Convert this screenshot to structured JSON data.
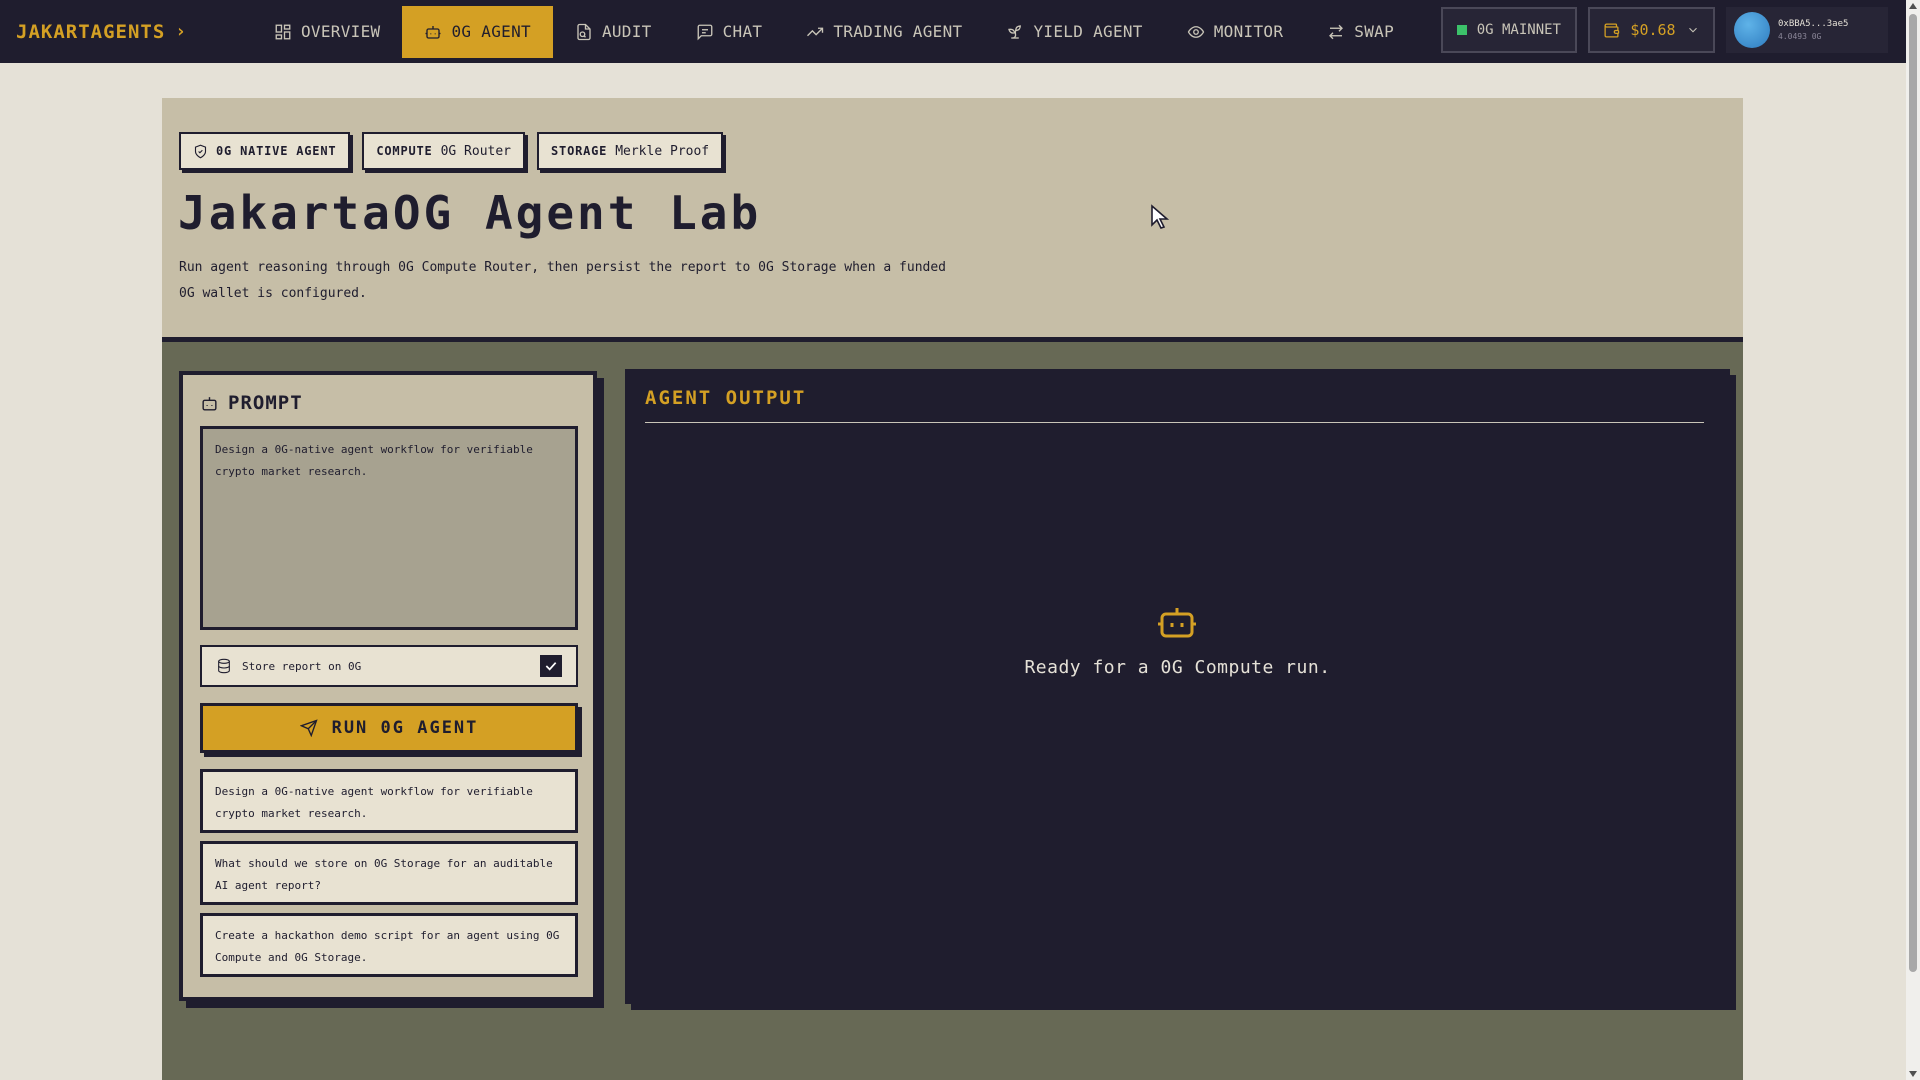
{
  "brand": {
    "name": "JAKARTAGENTS",
    "chevron": "›"
  },
  "nav": {
    "items": [
      {
        "label": "OVERVIEW",
        "icon": "layout-grid-icon",
        "active": false
      },
      {
        "label": "0G AGENT",
        "icon": "robot-icon",
        "active": true
      },
      {
        "label": "AUDIT",
        "icon": "file-audit-icon",
        "active": false
      },
      {
        "label": "CHAT",
        "icon": "chat-icon",
        "active": false
      },
      {
        "label": "TRADING AGENT",
        "icon": "trending-up-icon",
        "active": false
      },
      {
        "label": "YIELD AGENT",
        "icon": "sprout-icon",
        "active": false
      },
      {
        "label": "MONITOR",
        "icon": "eye-icon",
        "active": false
      },
      {
        "label": "SWAP",
        "icon": "swap-icon",
        "active": false
      }
    ],
    "network": "0G MAINNET",
    "balance": "$0.68",
    "account": {
      "address": "0xBBA5...3ae5",
      "balance": "4.0493 0G"
    }
  },
  "hero": {
    "badges": [
      {
        "strong": "0G NATIVE AGENT",
        "light": ""
      },
      {
        "strong": "COMPUTE",
        "light": "0G Router"
      },
      {
        "strong": "STORAGE",
        "light": "Merkle Proof"
      }
    ],
    "title": "JakartaOG Agent Lab",
    "description": "Run agent reasoning through 0G Compute Router, then persist the report to 0G Storage when a funded 0G wallet is configured."
  },
  "prompt": {
    "heading": "PROMPT",
    "value": "Design a 0G-native agent workflow for verifiable crypto market research.",
    "store_label": "Store report on 0G",
    "store_checked": true,
    "run_label": "RUN 0G AGENT",
    "suggestions": [
      "Design a 0G-native agent workflow for verifiable crypto market research.",
      "What should we store on 0G Storage for an auditable AI agent report?",
      "Create a hackathon demo script for an agent using 0G Compute and 0G Storage."
    ]
  },
  "output": {
    "title": "AGENT OUTPUT",
    "empty_text": "Ready for a 0G Compute run."
  },
  "colors": {
    "nav_bg": "#1f1d2e",
    "accent": "#d4a024",
    "hero_bg": "#c6bea7",
    "work_bg": "#676955",
    "network_dot": "#3cc26a"
  }
}
